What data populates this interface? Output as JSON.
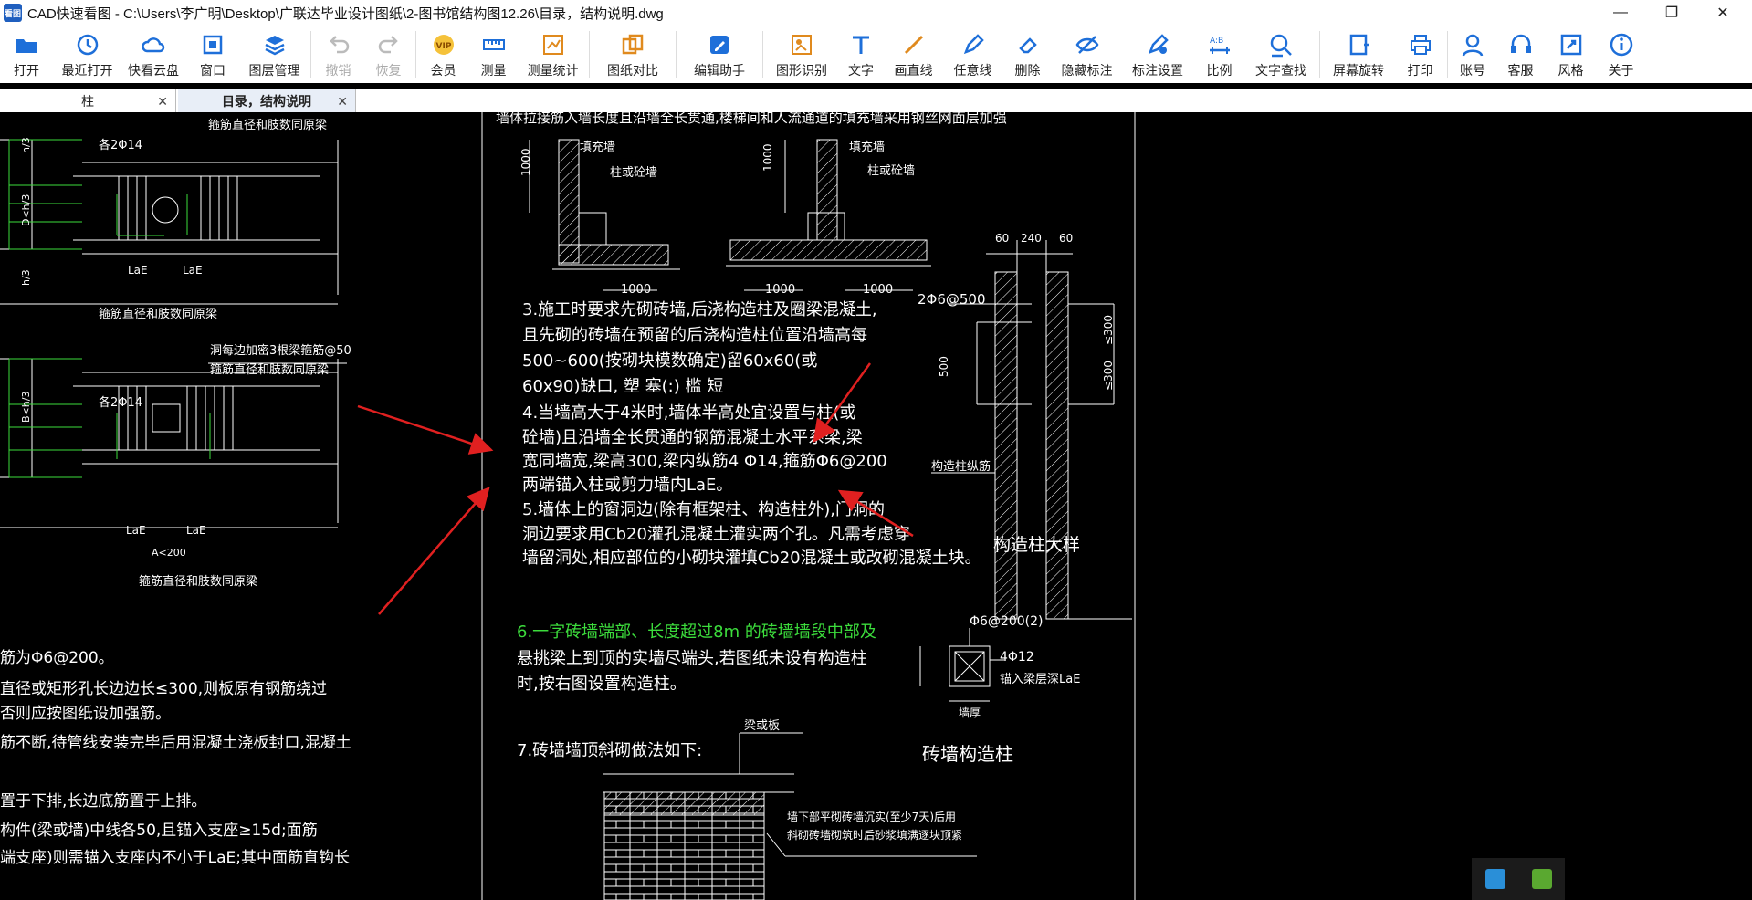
{
  "window": {
    "title": "CAD快速看图 - C:\\Users\\李广明\\Desktop\\广联达毕业设计图纸\\2-图书馆结构图12.26\\目录，结构说明.dwg",
    "app_icon_label": "看图"
  },
  "toolbar": {
    "items": [
      {
        "label": "打开",
        "icon": "folder-open-icon",
        "enabled": true
      },
      {
        "label": "最近打开",
        "icon": "history-icon",
        "enabled": true
      },
      {
        "label": "快看云盘",
        "icon": "cloud-icon",
        "enabled": true
      },
      {
        "label": "窗口",
        "icon": "window-icon",
        "enabled": true
      },
      {
        "label": "图层管理",
        "icon": "layers-icon",
        "enabled": true
      },
      {
        "label": "撤销",
        "icon": "undo-icon",
        "enabled": false
      },
      {
        "label": "恢复",
        "icon": "redo-icon",
        "enabled": false
      },
      {
        "label": "会员",
        "icon": "vip-icon",
        "enabled": true
      },
      {
        "label": "测量",
        "icon": "ruler-icon",
        "enabled": true
      },
      {
        "label": "测量统计",
        "icon": "measure-stats-icon",
        "enabled": true
      },
      {
        "label": "图纸对比",
        "icon": "compare-icon",
        "enabled": true
      },
      {
        "label": "编辑助手",
        "icon": "edit-assistant-icon",
        "enabled": true
      },
      {
        "label": "图形识别",
        "icon": "shape-recognition-icon",
        "enabled": true
      },
      {
        "label": "文字",
        "icon": "text-icon",
        "enabled": true
      },
      {
        "label": "画直线",
        "icon": "line-icon",
        "enabled": true
      },
      {
        "label": "任意线",
        "icon": "pen-icon",
        "enabled": true
      },
      {
        "label": "删除",
        "icon": "eraser-icon",
        "enabled": true
      },
      {
        "label": "隐藏标注",
        "icon": "hide-eye-icon",
        "enabled": true
      },
      {
        "label": "标注设置",
        "icon": "annotation-settings-icon",
        "enabled": true
      },
      {
        "label": "比例",
        "icon": "scale-icon",
        "enabled": true
      },
      {
        "label": "文字查找",
        "icon": "text-search-icon",
        "enabled": true
      },
      {
        "label": "屏幕旋转",
        "icon": "rotate-screen-icon",
        "enabled": true
      },
      {
        "label": "打印",
        "icon": "printer-icon",
        "enabled": true
      },
      {
        "label": "账号",
        "icon": "user-icon",
        "enabled": true
      },
      {
        "label": "客服",
        "icon": "headset-icon",
        "enabled": true
      },
      {
        "label": "风格",
        "icon": "style-icon",
        "enabled": true
      },
      {
        "label": "关于",
        "icon": "info-icon",
        "enabled": true
      }
    ]
  },
  "tabs": [
    {
      "label": "柱",
      "active": false
    },
    {
      "label": "目录，结构说明",
      "active": true
    }
  ],
  "drawing": {
    "top_partial": "墙体拉接筋入墙长度且沿墙全长贯通,楼梯间和人流通道的填充墙采用钢丝网面层加强",
    "left_labels": {
      "rebar1": "箍筋直径和肢数同原梁",
      "bar1": "各2Φ14",
      "hole_note": "洞每边加密3根梁箍筋@50",
      "rebar2": "箍筋直径和肢数同原梁",
      "bar2": "各2Φ14",
      "rebar3": "箍筋直径和肢数同原梁",
      "rebar4": "箍筋直径和肢数同原梁",
      "a_dim": "A<200",
      "lae": "LaE",
      "h3": "h/3",
      "dh3": "D<h/3",
      "bh3": "B<h/3"
    },
    "left_notes": [
      "筋为Φ6@200。",
      "直径或矩形孔长边边长≤300,则板原有钢筋绕过",
      "否则应按图纸设加强筋。",
      "筋不断,待管线安装完毕后用混凝土浇板封口,混凝土",
      "置于下排,长边底筋置于上排。",
      "构件(梁或墙)中线各50,且锚入支座≥15d;面筋",
      "端支座)则需锚入支座内不小于LaE;其中面筋直钩长"
    ],
    "wall_labels": {
      "fill_wall": "填充墙",
      "column_or_wall": "柱或砼墙",
      "d1000": "1000"
    },
    "notes_center": [
      "3.施工时要求先砌砖墙,后浇构造柱及圈梁混凝土,",
      "且先砌的砖墙在预留的后浇构造柱位置沿墙高每",
      "500~600(按砌块模数确定)留60x60(或",
      "60x90)缺口,       塑  塞(:)  槛    短",
      "4.当墙高大于4米时,墙体半高处宜设置与柱(或",
      "砼墙)且沿墙全长贯通的钢筋混凝土水平系梁,梁",
      "宽同墙宽,梁高300,梁内纵筋4 Φ14,箍筋Φ6@200",
      "两端锚入柱或剪力墙内LaE。",
      "5.墙体上的窗洞边(除有框架柱、构造柱外),门洞的",
      "洞边要求用Cb20灌孔混凝土灌实两个孔。凡需考虑穿",
      "墙留洞处,相应部位的小砌块灌填Cb20混凝土或改砌混凝土块。"
    ],
    "note6_green": "6.一字砖墙端部、长度超过8m 的砖墙墙段中部及",
    "note6_rest": [
      "悬挑梁上到顶的实墙尽端头,若图纸未设有构造柱",
      "时,按右图设置构造柱。"
    ],
    "note7": "7.砖墙墙顶斜砌做法如下:",
    "beam_label": "梁或板",
    "brick_note": [
      "墙下部平砌砖墙沉实(至少7天)后用",
      "斜砌砖墙砌筑时后砂浆填满逐块顶紧"
    ],
    "right_detail": {
      "dims": [
        "60",
        "240",
        "60"
      ],
      "rebar": "2Φ6@500",
      "d500": "500",
      "d300a": "≤300",
      "d300b": "≤300",
      "column_bar": "构造柱纵筋",
      "title": "构造柱大样"
    },
    "brick_column": {
      "stirrup": "Φ6@200(2)",
      "bars": "4Φ12",
      "anchor": "锚入梁层深LaE",
      "width": "墙厚",
      "title": "砖墙构造柱"
    }
  },
  "colors": {
    "canvas": "#000000",
    "cad_white": "#ffffff",
    "cad_green": "#3cdc3c",
    "arrow_red": "#e02020",
    "icon_blue": "#1e6fd9"
  }
}
